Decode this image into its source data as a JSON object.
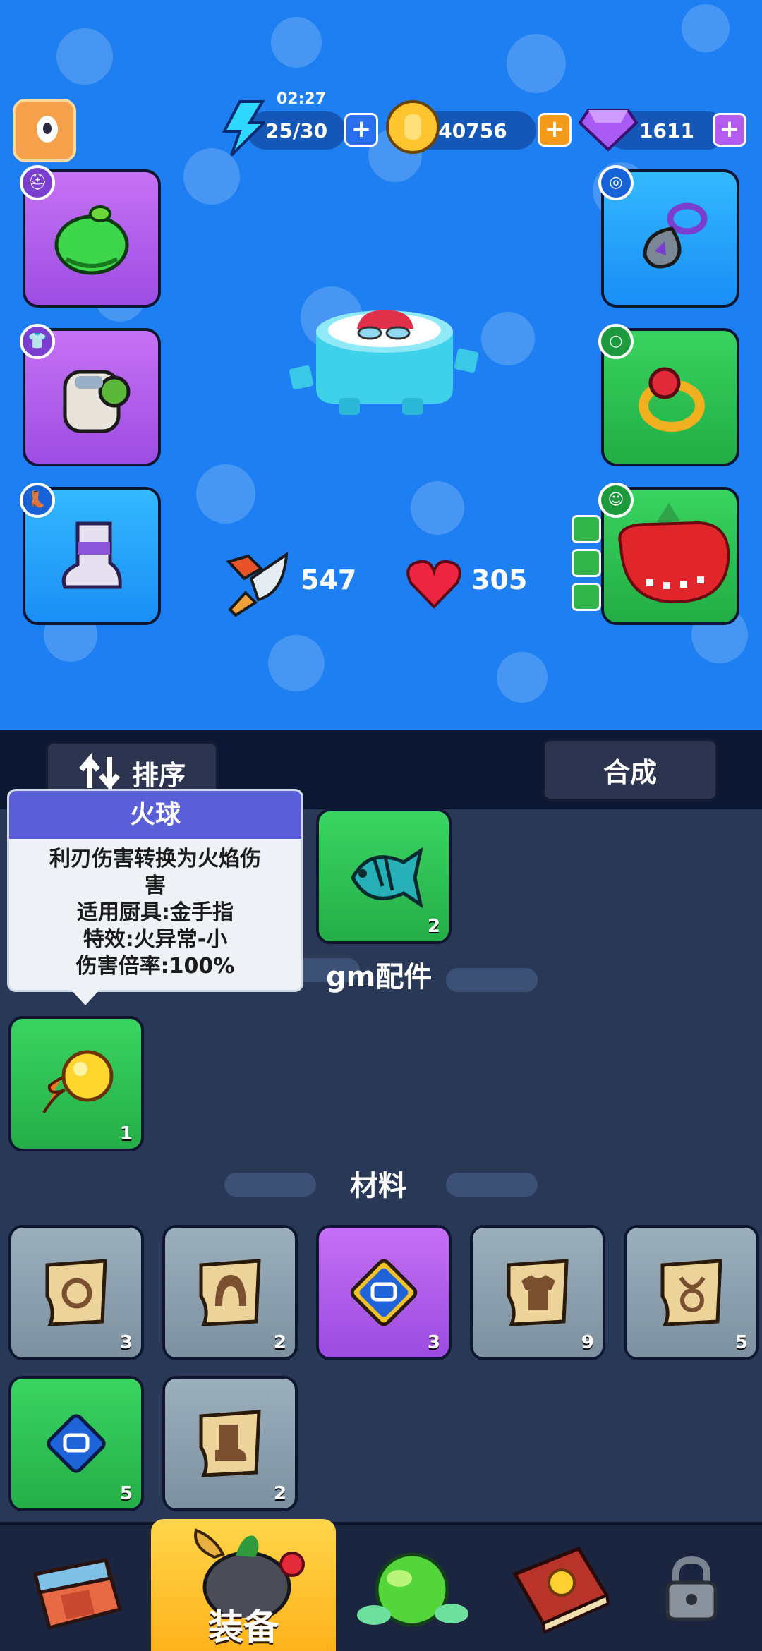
{
  "hud": {
    "energy_timer": "02:27",
    "energy": "25/30",
    "coins": "40756",
    "gems": "1611",
    "plus": "+"
  },
  "stats": {
    "attack": "547",
    "health": "305"
  },
  "toolbar": {
    "sort_label": "排序",
    "combine_label": "合成"
  },
  "tooltip": {
    "title": "火球",
    "lines": [
      "利刃伤害转换为火焰伤",
      "害",
      "适用厨具:金手指",
      "特效:火异常-小",
      "伤害倍率:100%"
    ]
  },
  "inventory": {
    "top_item_count": "2",
    "gm_section": "gm配件",
    "gm_items": [
      {
        "count": "1"
      }
    ],
    "materials_section": "材料",
    "materials": [
      {
        "count": "3"
      },
      {
        "count": "2"
      },
      {
        "count": "3"
      },
      {
        "count": "9"
      },
      {
        "count": "5"
      },
      {
        "count": "5"
      },
      {
        "count": "2"
      }
    ]
  },
  "nav": {
    "equip_label": "装备"
  },
  "colors": {
    "accent_blue": "#1e7ff2",
    "panel": "#2a3858",
    "gold": "#ffc52e"
  },
  "icons": [
    "lightning-icon",
    "coin-icon",
    "gem-icon",
    "helmet-icon",
    "armor-icon",
    "boots-icon",
    "amulet-icon",
    "ring-icon",
    "pet-icon",
    "sword-icon",
    "heart-icon",
    "swap-icon",
    "fireball-icon",
    "fish-icon",
    "lock-icon"
  ]
}
